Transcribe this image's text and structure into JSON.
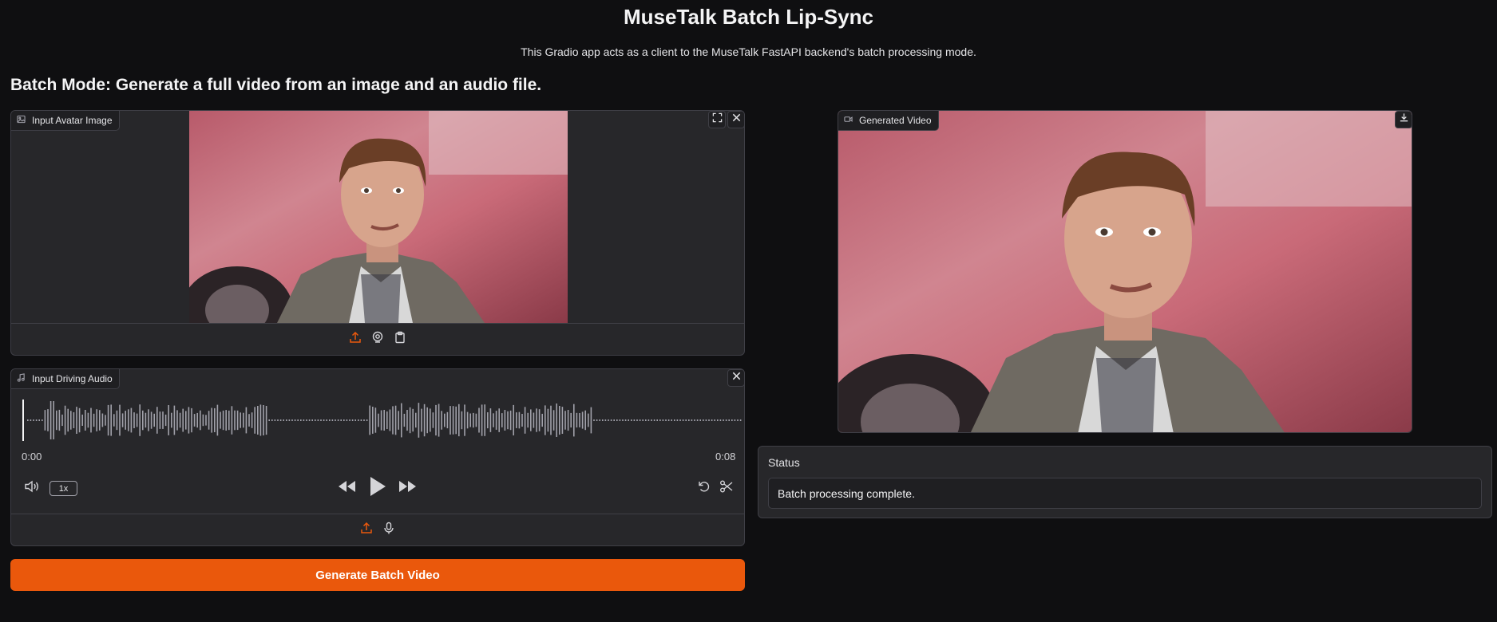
{
  "header": {
    "title": "MuseTalk Batch Lip-Sync",
    "subtitle": "This Gradio app acts as a client to the MuseTalk FastAPI backend's batch processing mode.",
    "section_heading": "Batch Mode: Generate a full video from an image and an audio file."
  },
  "image_input": {
    "label": "Input Avatar Image",
    "icon": "image-icon",
    "sources": [
      "upload-icon",
      "webcam-icon",
      "clipboard-icon"
    ],
    "active_source": "upload-icon"
  },
  "audio_input": {
    "label": "Input Driving Audio",
    "icon": "music-note-icon",
    "current_time": "0:00",
    "duration": "0:08",
    "playback_rate": "1x",
    "sources": [
      "upload-icon",
      "microphone-icon"
    ],
    "active_source": "upload-icon"
  },
  "generate_button": {
    "label": "Generate Batch Video"
  },
  "video_output": {
    "label": "Generated Video",
    "icon": "video-icon"
  },
  "status": {
    "label": "Status",
    "value": "Batch processing complete."
  },
  "colors": {
    "background": "#0f0f11",
    "panel": "#27272a",
    "accent": "#ea580c"
  }
}
